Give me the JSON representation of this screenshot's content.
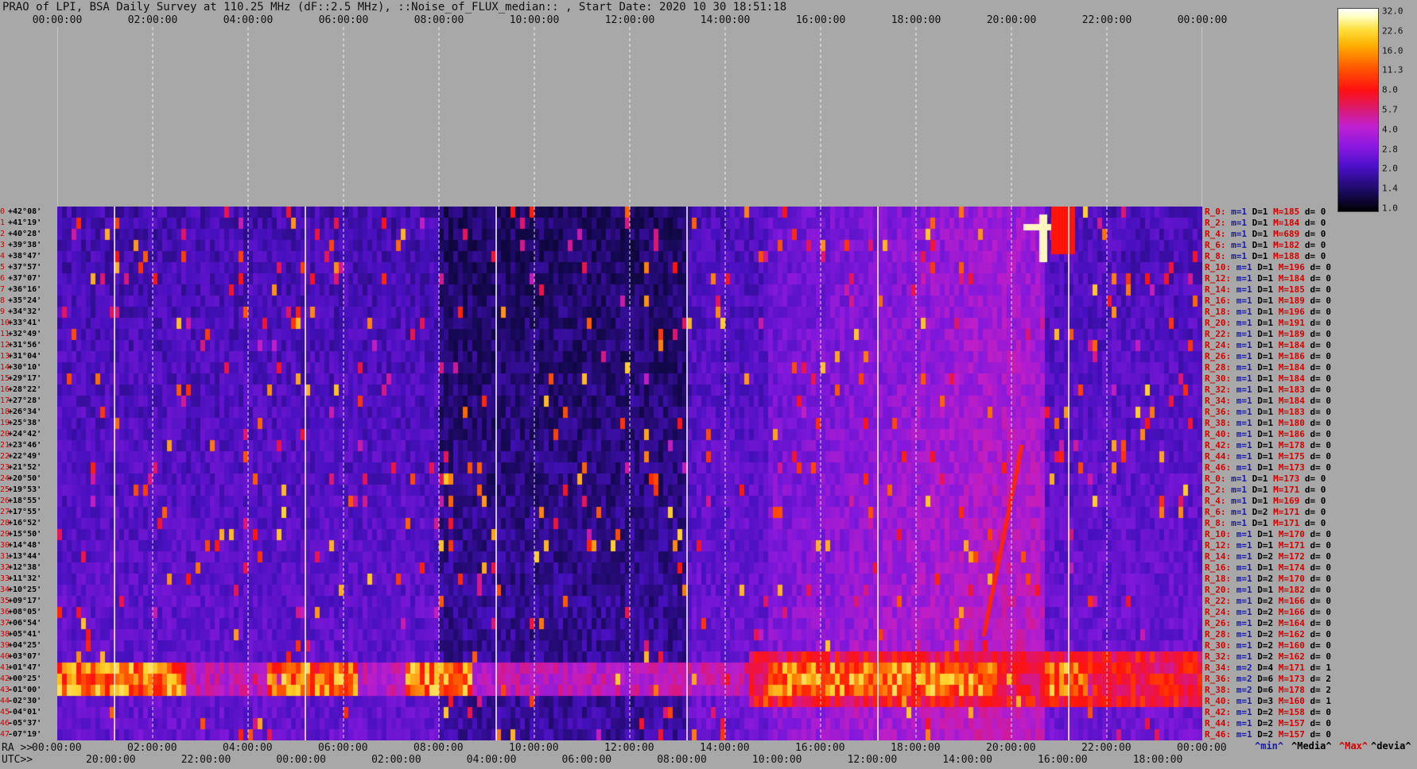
{
  "title": "PRAO of LPI, BSA Daily Survey at 110.25 MHz (dF::2.5 MHz), ::Noise_of_FLUX_median:: , Start Date: 2020 10 30 18:51:18",
  "top_axis": [
    "00:00:00",
    "02:00:00",
    "04:00:00",
    "06:00:00",
    "08:00:00",
    "10:00:00",
    "12:00:00",
    "14:00:00",
    "16:00:00",
    "18:00:00",
    "20:00:00",
    "22:00:00",
    "00:00:00"
  ],
  "bottom_axis": {
    "ra_prefix": "RA >>",
    "utc_prefix": "UTC>>",
    "ra": [
      "00:00:00",
      "02:00:00",
      "04:00:00",
      "06:00:00",
      "08:00:00",
      "10:00:00",
      "12:00:00",
      "14:00:00",
      "16:00:00",
      "18:00:00",
      "20:00:00",
      "22:00:00",
      "00:00:00"
    ],
    "utc": [
      "20:00:00",
      "22:00:00",
      "00:00:00",
      "02:00:00",
      "04:00:00",
      "06:00:00",
      "08:00:00",
      "10:00:00",
      "12:00:00",
      "14:00:00",
      "16:00:00",
      "18:00:00"
    ]
  },
  "colorbar": {
    "ticks": [
      "32.0",
      "22.6",
      "16.0",
      "11.3",
      "8.0",
      "5.7",
      "4.0",
      "2.8",
      "2.0",
      "1.4",
      "1.0"
    ]
  },
  "declinations": [
    "+42°08'",
    "+41°19'",
    "+40°28'",
    "+39°38'",
    "+38°47'",
    "+37°57'",
    "+37°07'",
    "+36°16'",
    "+35°24'",
    "+34°32'",
    "+33°41'",
    "+32°49'",
    "+31°56'",
    "+31°04'",
    "+30°10'",
    "+29°17'",
    "+28°22'",
    "+27°28'",
    "+26°34'",
    "+25°38'",
    "+24°42'",
    "+23°46'",
    "+22°49'",
    "+21°52'",
    "+20°50'",
    "+19°53'",
    "+18°55'",
    "+17°55'",
    "+16°52'",
    "+15°50'",
    "+14°48'",
    "+13°44'",
    "+12°38'",
    "+11°32'",
    "+10°25'",
    "+09°17'",
    "+08°05'",
    "+06°54'",
    "+05°41'",
    "+04°25'",
    "+03°07'",
    "+01°47'",
    "+00°25'",
    "-01°00'",
    "-02°30'",
    "-04°01'",
    "-05°37'",
    "-07°19'"
  ],
  "row_stats": [
    {
      "r": "R_0:",
      "m": "m=1",
      "D": "D=1",
      "M": "M=185",
      "d": "d= 0"
    },
    {
      "r": "R_2:",
      "m": "m=1",
      "D": "D=1",
      "M": "M=184",
      "d": "d= 0"
    },
    {
      "r": "R_4:",
      "m": "m=1",
      "D": "D=1",
      "M": "M=689",
      "d": "d= 0"
    },
    {
      "r": "R_6:",
      "m": "m=1",
      "D": "D=1",
      "M": "M=182",
      "d": "d= 0"
    },
    {
      "r": "R_8:",
      "m": "m=1",
      "D": "D=1",
      "M": "M=188",
      "d": "d= 0"
    },
    {
      "r": "R_10:",
      "m": "m=1",
      "D": "D=1",
      "M": "M=196",
      "d": "d= 0"
    },
    {
      "r": "R_12:",
      "m": "m=1",
      "D": "D=1",
      "M": "M=184",
      "d": "d= 0"
    },
    {
      "r": "R_14:",
      "m": "m=1",
      "D": "D=1",
      "M": "M=185",
      "d": "d= 0"
    },
    {
      "r": "R_16:",
      "m": "m=1",
      "D": "D=1",
      "M": "M=189",
      "d": "d= 0"
    },
    {
      "r": "R_18:",
      "m": "m=1",
      "D": "D=1",
      "M": "M=196",
      "d": "d= 0"
    },
    {
      "r": "R_20:",
      "m": "m=1",
      "D": "D=1",
      "M": "M=191",
      "d": "d= 0"
    },
    {
      "r": "R_22:",
      "m": "m=1",
      "D": "D=1",
      "M": "M=189",
      "d": "d= 0"
    },
    {
      "r": "R_24:",
      "m": "m=1",
      "D": "D=1",
      "M": "M=184",
      "d": "d= 0"
    },
    {
      "r": "R_26:",
      "m": "m=1",
      "D": "D=1",
      "M": "M=186",
      "d": "d= 0"
    },
    {
      "r": "R_28:",
      "m": "m=1",
      "D": "D=1",
      "M": "M=184",
      "d": "d= 0"
    },
    {
      "r": "R_30:",
      "m": "m=1",
      "D": "D=1",
      "M": "M=184",
      "d": "d= 0"
    },
    {
      "r": "R_32:",
      "m": "m=1",
      "D": "D=1",
      "M": "M=183",
      "d": "d= 0"
    },
    {
      "r": "R_34:",
      "m": "m=1",
      "D": "D=1",
      "M": "M=184",
      "d": "d= 0"
    },
    {
      "r": "R_36:",
      "m": "m=1",
      "D": "D=1",
      "M": "M=183",
      "d": "d= 0"
    },
    {
      "r": "R_38:",
      "m": "m=1",
      "D": "D=1",
      "M": "M=180",
      "d": "d= 0"
    },
    {
      "r": "R_40:",
      "m": "m=1",
      "D": "D=1",
      "M": "M=186",
      "d": "d= 0"
    },
    {
      "r": "R_42:",
      "m": "m=1",
      "D": "D=1",
      "M": "M=178",
      "d": "d= 0"
    },
    {
      "r": "R_44:",
      "m": "m=1",
      "D": "D=1",
      "M": "M=175",
      "d": "d= 0"
    },
    {
      "r": "R_46:",
      "m": "m=1",
      "D": "D=1",
      "M": "M=173",
      "d": "d= 0"
    },
    {
      "r": "R_0:",
      "m": "m=1",
      "D": "D=1",
      "M": "M=173",
      "d": "d= 0"
    },
    {
      "r": "R_2:",
      "m": "m=1",
      "D": "D=1",
      "M": "M=171",
      "d": "d= 0"
    },
    {
      "r": "R_4:",
      "m": "m=1",
      "D": "D=1",
      "M": "M=169",
      "d": "d= 0"
    },
    {
      "r": "R_6:",
      "m": "m=1",
      "D": "D=2",
      "M": "M=171",
      "d": "d= 0"
    },
    {
      "r": "R_8:",
      "m": "m=1",
      "D": "D=1",
      "M": "M=171",
      "d": "d= 0"
    },
    {
      "r": "R_10:",
      "m": "m=1",
      "D": "D=1",
      "M": "M=170",
      "d": "d= 0"
    },
    {
      "r": "R_12:",
      "m": "m=1",
      "D": "D=1",
      "M": "M=171",
      "d": "d= 0"
    },
    {
      "r": "R_14:",
      "m": "m=1",
      "D": "D=2",
      "M": "M=172",
      "d": "d= 0"
    },
    {
      "r": "R_16:",
      "m": "m=1",
      "D": "D=1",
      "M": "M=174",
      "d": "d= 0"
    },
    {
      "r": "R_18:",
      "m": "m=1",
      "D": "D=2",
      "M": "M=170",
      "d": "d= 0"
    },
    {
      "r": "R_20:",
      "m": "m=1",
      "D": "D=1",
      "M": "M=182",
      "d": "d= 0"
    },
    {
      "r": "R_22:",
      "m": "m=1",
      "D": "D=2",
      "M": "M=166",
      "d": "d= 0"
    },
    {
      "r": "R_24:",
      "m": "m=1",
      "D": "D=2",
      "M": "M=166",
      "d": "d= 0"
    },
    {
      "r": "R_26:",
      "m": "m=1",
      "D": "D=2",
      "M": "M=164",
      "d": "d= 0"
    },
    {
      "r": "R_28:",
      "m": "m=1",
      "D": "D=2",
      "M": "M=162",
      "d": "d= 0"
    },
    {
      "r": "R_30:",
      "m": "m=1",
      "D": "D=2",
      "M": "M=160",
      "d": "d= 0"
    },
    {
      "r": "R_32:",
      "m": "m=1",
      "D": "D=2",
      "M": "M=162",
      "d": "d= 0"
    },
    {
      "r": "R_34:",
      "m": "m=2",
      "D": "D=4",
      "M": "M=171",
      "d": "d= 1"
    },
    {
      "r": "R_36:",
      "m": "m=2",
      "D": "D=6",
      "M": "M=173",
      "d": "d= 2"
    },
    {
      "r": "R_38:",
      "m": "m=2",
      "D": "D=6",
      "M": "M=178",
      "d": "d= 2"
    },
    {
      "r": "R_40:",
      "m": "m=1",
      "D": "D=3",
      "M": "M=160",
      "d": "d= 1"
    },
    {
      "r": "R_42:",
      "m": "m=1",
      "D": "D=2",
      "M": "M=158",
      "d": "d= 0"
    },
    {
      "r": "R_44:",
      "m": "m=1",
      "D": "D=2",
      "M": "M=157",
      "d": "d= 0"
    },
    {
      "r": "R_46:",
      "m": "m=1",
      "D": "D=2",
      "M": "M=157",
      "d": "d= 0"
    }
  ],
  "legend": [
    "^min^",
    "^Media^",
    "^Max^",
    "^devia^"
  ],
  "chart_data": {
    "type": "heatmap",
    "title": "PRAO of LPI, BSA Daily Survey at 110.25 MHz (dF::2.5 MHz), ::Noise_of_FLUX_median:: , Start Date: 2020 10 30 18:51:18",
    "x_top_ticks": [
      "00:00:00",
      "02:00:00",
      "04:00:00",
      "06:00:00",
      "08:00:00",
      "10:00:00",
      "12:00:00",
      "14:00:00",
      "16:00:00",
      "18:00:00",
      "20:00:00",
      "22:00:00",
      "00:00:00"
    ],
    "colorbar_scale": [
      32.0,
      22.6,
      16.0,
      11.3,
      8.0,
      5.7,
      4.0,
      2.8,
      2.0,
      1.4,
      1.0
    ],
    "rows": 48,
    "colors": {
      "background": "#a8a8a8",
      "low": "#000000",
      "mid": "#8a18e0",
      "high": "#ff1010",
      "peak": "#ffffff"
    }
  }
}
